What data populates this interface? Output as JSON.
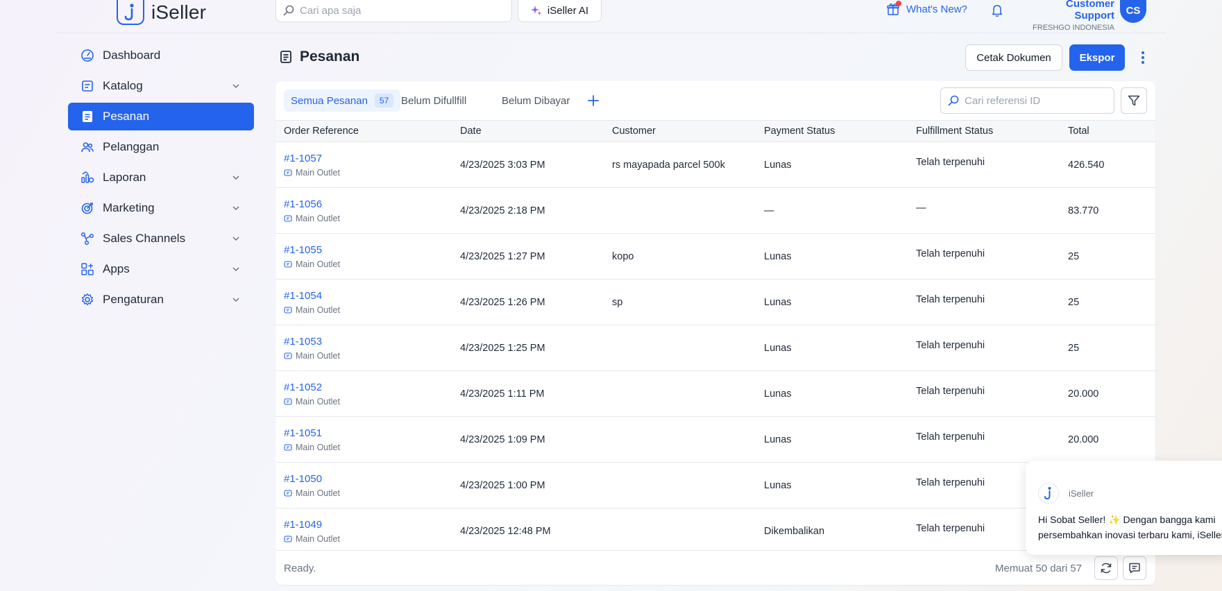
{
  "app": {
    "brand": "iSeller"
  },
  "header": {
    "search_placeholder": "Cari apa saja",
    "ai_label": "iSeller AI",
    "whats_new": "What's New?",
    "support_name": "Customer Support",
    "support_org": "FRESHGO INDONESIA",
    "avatar_initials": "CS"
  },
  "sidebar": {
    "items": [
      {
        "label": "Dashboard",
        "icon": "dashboard-icon",
        "chevron": false,
        "active": false
      },
      {
        "label": "Katalog",
        "icon": "catalog-icon",
        "chevron": true,
        "active": false
      },
      {
        "label": "Pesanan",
        "icon": "orders-icon",
        "chevron": false,
        "active": true
      },
      {
        "label": "Pelanggan",
        "icon": "customers-icon",
        "chevron": false,
        "active": false
      },
      {
        "label": "Laporan",
        "icon": "reports-icon",
        "chevron": true,
        "active": false
      },
      {
        "label": "Marketing",
        "icon": "target-icon",
        "chevron": true,
        "active": false
      },
      {
        "label": "Sales Channels",
        "icon": "channels-icon",
        "chevron": true,
        "active": false
      },
      {
        "label": "Apps",
        "icon": "apps-icon",
        "chevron": true,
        "active": false
      },
      {
        "label": "Pengaturan",
        "icon": "gear-icon",
        "chevron": true,
        "active": false
      }
    ]
  },
  "page": {
    "title": "Pesanan",
    "print_button": "Cetak Dokumen",
    "export_button": "Ekspor"
  },
  "tabs": [
    {
      "label": "Semua Pesanan",
      "badge": "57",
      "active": true
    },
    {
      "label": "Belum Difullfill",
      "badge": "",
      "active": false
    },
    {
      "label": "Belum Dibayar",
      "badge": "",
      "active": false
    }
  ],
  "ref_search_placeholder": "Cari referensi ID",
  "table": {
    "columns": [
      "Order Reference",
      "Date",
      "Customer",
      "Payment Status",
      "Fulfillment Status",
      "Total"
    ],
    "rows": [
      {
        "ref": "#1-1057",
        "outlet": "Main Outlet",
        "date": "4/23/2025 3:03 PM",
        "customer": "rs mayapada parcel 500k",
        "payment": "Lunas",
        "fulfillment": "Telah terpenuhi",
        "total": "426.540"
      },
      {
        "ref": "#1-1056",
        "outlet": "Main Outlet",
        "date": "4/23/2025 2:18 PM",
        "customer": "",
        "payment": "—",
        "fulfillment": "—",
        "total": "83.770"
      },
      {
        "ref": "#1-1055",
        "outlet": "Main Outlet",
        "date": "4/23/2025 1:27 PM",
        "customer": "kopo",
        "payment": "Lunas",
        "fulfillment": "Telah terpenuhi",
        "total": "25"
      },
      {
        "ref": "#1-1054",
        "outlet": "Main Outlet",
        "date": "4/23/2025 1:26 PM",
        "customer": "sp",
        "payment": "Lunas",
        "fulfillment": "Telah terpenuhi",
        "total": "25"
      },
      {
        "ref": "#1-1053",
        "outlet": "Main Outlet",
        "date": "4/23/2025 1:25 PM",
        "customer": "",
        "payment": "Lunas",
        "fulfillment": "Telah terpenuhi",
        "total": "25"
      },
      {
        "ref": "#1-1052",
        "outlet": "Main Outlet",
        "date": "4/23/2025 1:11 PM",
        "customer": "",
        "payment": "Lunas",
        "fulfillment": "Telah terpenuhi",
        "total": "20.000"
      },
      {
        "ref": "#1-1051",
        "outlet": "Main Outlet",
        "date": "4/23/2025 1:09 PM",
        "customer": "",
        "payment": "Lunas",
        "fulfillment": "Telah terpenuhi",
        "total": "20.000"
      },
      {
        "ref": "#1-1050",
        "outlet": "Main Outlet",
        "date": "4/23/2025 1:00 PM",
        "customer": "",
        "payment": "Lunas",
        "fulfillment": "Telah terpenuhi",
        "total": ""
      },
      {
        "ref": "#1-1049",
        "outlet": "Main Outlet",
        "date": "4/23/2025 12:48 PM",
        "customer": "",
        "payment": "Dikembalikan",
        "fulfillment": "Telah terpenuhi",
        "total": ""
      }
    ]
  },
  "footer": {
    "status": "Ready.",
    "count": "Memuat 50 dari 57"
  },
  "chat": {
    "sender": "iSeller",
    "line1": "Hi Sobat Seller! ✨ Dengan bangga kami",
    "line2": "persembahkan inovasi terbaru kami, iSeller"
  },
  "colors": {
    "accent": "#2463eb",
    "link": "#2563eb",
    "notification": "#ef4444"
  }
}
